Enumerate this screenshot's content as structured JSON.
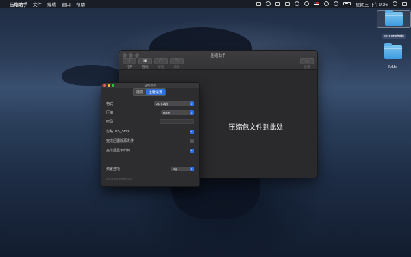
{
  "menubar": {
    "app_name": "压缩助手",
    "menus": [
      "文件",
      "编辑",
      "窗口",
      "帮助"
    ],
    "clock": "星期三 下午9:26"
  },
  "desktop": {
    "icons": [
      {
        "label": "screenshots",
        "selected": true
      },
      {
        "label": "folder",
        "selected": false
      }
    ]
  },
  "main_window": {
    "title": "压缩助手",
    "toolbar": {
      "open": {
        "glyph": "+",
        "label": "打开"
      },
      "compress": {
        "glyph": "▣",
        "label": "压缩"
      },
      "extract": {
        "glyph": "▢",
        "label": "解压"
      },
      "preview": {
        "glyph": "▢",
        "label": "预览"
      },
      "settings": {
        "glyph": "▭",
        "label": "设置"
      }
    },
    "drop_text": "压缩包文件到此处"
  },
  "settings_panel": {
    "title": "压缩助手",
    "tabs": [
      "拖拽",
      "压缩设置"
    ],
    "format": {
      "label": "格式",
      "value": "zip (.zip)"
    },
    "compression": {
      "label": "压缩",
      "value": "none"
    },
    "password": {
      "label": "密码",
      "value": ""
    },
    "ignore_ds_store": {
      "label": "忽略 .DS_Store",
      "checked": true
    },
    "delete_after": {
      "label": "完成后删除源文件",
      "checked": false
    },
    "show_after": {
      "label": "完成后显示归档",
      "checked": true
    },
    "preset": {
      "label": "预置选项",
      "value": ".zip"
    },
    "hint": "保存常用设置为预置选项"
  },
  "colors": {
    "accent": "#2f6fdd",
    "window_bg": "#2a2a2c"
  }
}
